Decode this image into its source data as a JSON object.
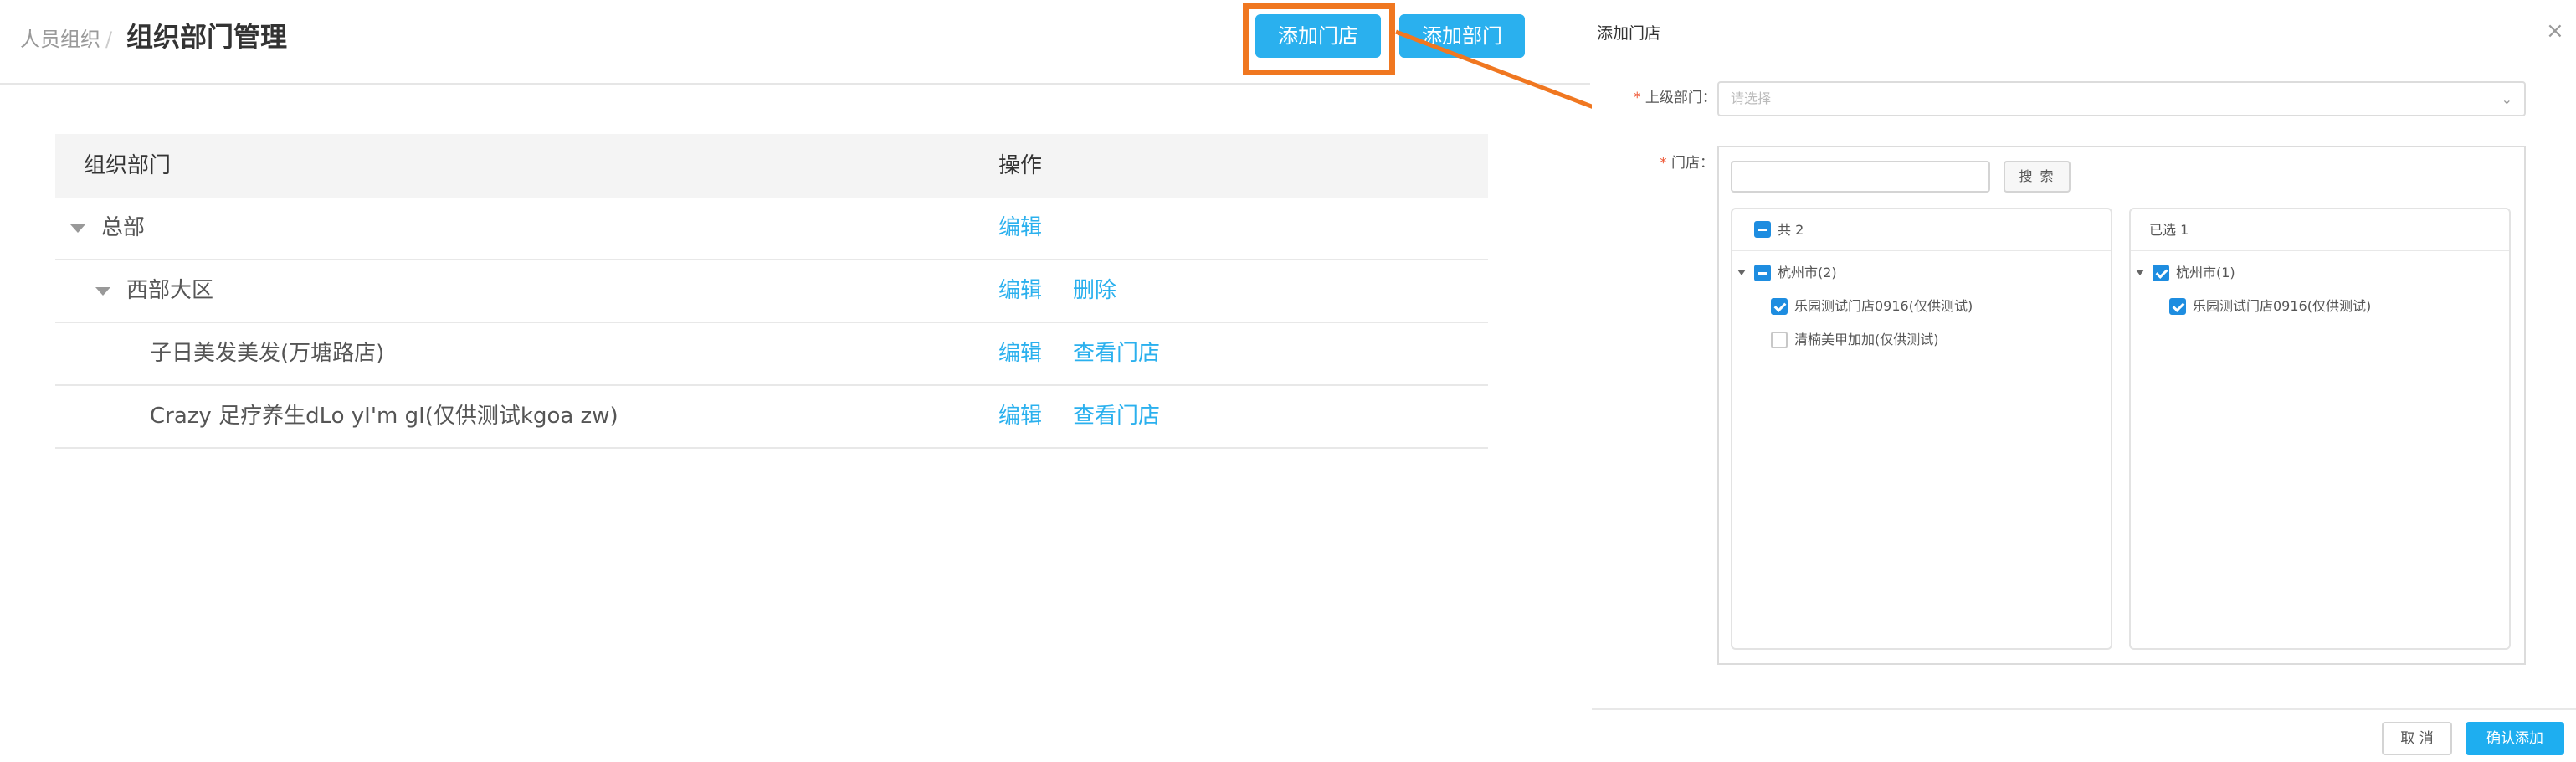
{
  "breadcrumb": {
    "parent": "人员组织",
    "separator": "/",
    "title": "组织部门管理"
  },
  "header_buttons": {
    "add_store": "添加门店",
    "add_department": "添加部门"
  },
  "table": {
    "columns": {
      "department": "组织部门",
      "actions": "操作"
    },
    "rows": [
      {
        "name": "总部",
        "actions": [
          "编辑"
        ]
      },
      {
        "name": "西部大区",
        "actions": [
          "编辑",
          "删除"
        ]
      },
      {
        "name": "子日美发美发(万塘路店)",
        "actions": [
          "编辑",
          "查看门店"
        ]
      },
      {
        "name": "Crazy 足疗养生dLo yI'm gI(仅供测试kgoa zw)",
        "actions": [
          "编辑",
          "查看门店"
        ]
      }
    ]
  },
  "dialog": {
    "title": "添加门店",
    "close_icon": "×",
    "parent_dept": {
      "required_mark": "*",
      "label": "上级部门：",
      "placeholder": "请选择",
      "chevron": "⌄"
    },
    "store": {
      "required_mark": "*",
      "label": "门店：",
      "search_input_value": "",
      "search_button": "搜 索",
      "left_panel": {
        "header": "共 2",
        "group": "杭州市(2)",
        "items": [
          {
            "label": "乐园测试门店0916(仅供测试)",
            "checked": true
          },
          {
            "label": "清楠美甲加加(仅供测试)",
            "checked": false
          }
        ]
      },
      "right_panel": {
        "header": "已选 1",
        "group": "杭州市(1)",
        "items": [
          {
            "label": "乐园测试门店0916(仅供测试)",
            "checked": true
          }
        ]
      }
    },
    "cancel_button": "取 消",
    "confirm_button": "确认添加"
  },
  "colors": {
    "accent": "#2ab0ee",
    "highlight": "#f07720",
    "link": "#2ab0ee",
    "checkbox": "#1e8de0"
  }
}
